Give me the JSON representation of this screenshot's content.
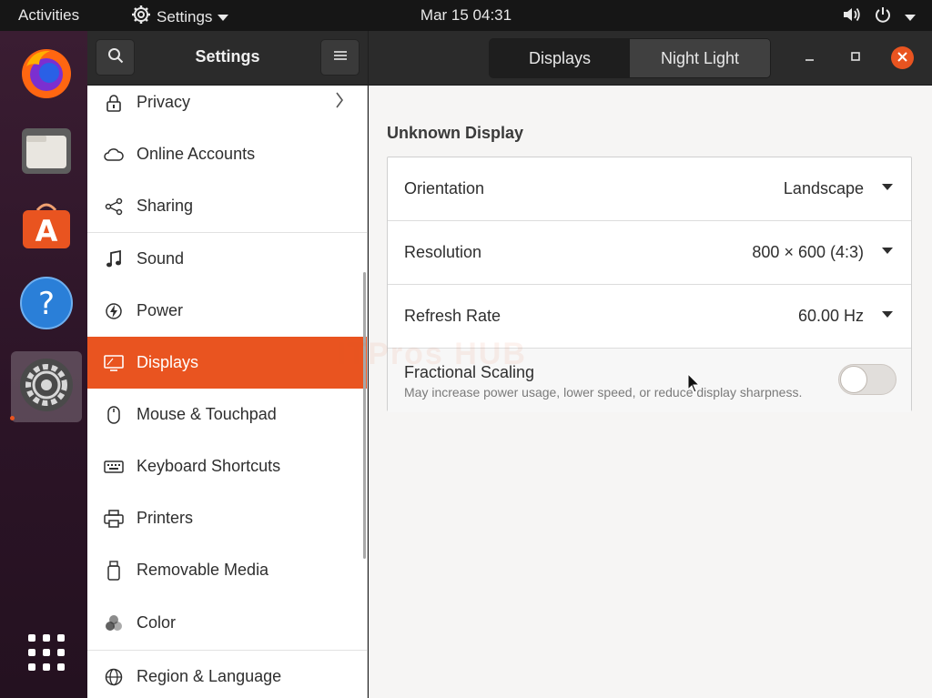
{
  "topbar": {
    "activities": "Activities",
    "app_menu": "Settings",
    "clock": "Mar 15  04:31"
  },
  "dock": {
    "items": [
      {
        "icon": "firefox-icon"
      },
      {
        "icon": "files-icon"
      },
      {
        "icon": "software-center-icon"
      },
      {
        "icon": "help-icon"
      },
      {
        "icon": "settings-icon",
        "active": true
      },
      {
        "icon": "show-applications-icon"
      }
    ]
  },
  "header": {
    "title": "Settings",
    "tabs": [
      {
        "label": "Displays",
        "active": true
      },
      {
        "label": "Night Light",
        "active": false
      }
    ]
  },
  "sidebar": {
    "items": [
      {
        "label": "Privacy",
        "icon": "lock-icon"
      },
      {
        "label": "Online Accounts",
        "icon": "cloud-icon"
      },
      {
        "label": "Sharing",
        "icon": "share-icon"
      },
      {
        "label": "Sound",
        "icon": "music-note-icon"
      },
      {
        "label": "Power",
        "icon": "power-icon"
      },
      {
        "label": "Displays",
        "icon": "display-icon",
        "selected": true
      },
      {
        "label": "Mouse & Touchpad",
        "icon": "mouse-icon"
      },
      {
        "label": "Keyboard Shortcuts",
        "icon": "keyboard-icon"
      },
      {
        "label": "Printers",
        "icon": "printer-icon"
      },
      {
        "label": "Removable Media",
        "icon": "usb-drive-icon"
      },
      {
        "label": "Color",
        "icon": "color-icon"
      },
      {
        "label": "Region & Language",
        "icon": "globe-icon"
      }
    ]
  },
  "main": {
    "section_title": "Unknown Display",
    "rows": [
      {
        "label": "Orientation",
        "value": "Landscape"
      },
      {
        "label": "Resolution",
        "value": "800 × 600 (4:3)"
      },
      {
        "label": "Refresh Rate",
        "value": "60.00 Hz"
      }
    ],
    "scaling": {
      "label": "Fractional Scaling",
      "description": "May increase power usage, lower speed, or reduce display sharpness.",
      "enabled": false
    },
    "watermark": "ITPros HUB"
  },
  "colors": {
    "accent": "#e95420",
    "topbar": "#161616",
    "headerbar": "#2b2b2b",
    "dock": "#2c1427"
  }
}
